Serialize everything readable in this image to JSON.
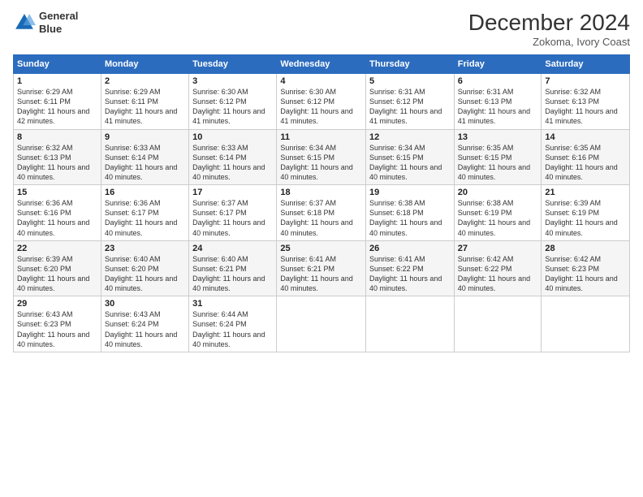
{
  "header": {
    "logo_line1": "General",
    "logo_line2": "Blue",
    "title": "December 2024",
    "location": "Zokoma, Ivory Coast"
  },
  "columns": [
    "Sunday",
    "Monday",
    "Tuesday",
    "Wednesday",
    "Thursday",
    "Friday",
    "Saturday"
  ],
  "weeks": [
    [
      {
        "day": "1",
        "sunrise": "6:29 AM",
        "sunset": "6:11 PM",
        "daylight": "11 hours and 42 minutes."
      },
      {
        "day": "2",
        "sunrise": "6:29 AM",
        "sunset": "6:11 PM",
        "daylight": "11 hours and 41 minutes."
      },
      {
        "day": "3",
        "sunrise": "6:30 AM",
        "sunset": "6:12 PM",
        "daylight": "11 hours and 41 minutes."
      },
      {
        "day": "4",
        "sunrise": "6:30 AM",
        "sunset": "6:12 PM",
        "daylight": "11 hours and 41 minutes."
      },
      {
        "day": "5",
        "sunrise": "6:31 AM",
        "sunset": "6:12 PM",
        "daylight": "11 hours and 41 minutes."
      },
      {
        "day": "6",
        "sunrise": "6:31 AM",
        "sunset": "6:13 PM",
        "daylight": "11 hours and 41 minutes."
      },
      {
        "day": "7",
        "sunrise": "6:32 AM",
        "sunset": "6:13 PM",
        "daylight": "11 hours and 41 minutes."
      }
    ],
    [
      {
        "day": "8",
        "sunrise": "6:32 AM",
        "sunset": "6:13 PM",
        "daylight": "11 hours and 40 minutes."
      },
      {
        "day": "9",
        "sunrise": "6:33 AM",
        "sunset": "6:14 PM",
        "daylight": "11 hours and 40 minutes."
      },
      {
        "day": "10",
        "sunrise": "6:33 AM",
        "sunset": "6:14 PM",
        "daylight": "11 hours and 40 minutes."
      },
      {
        "day": "11",
        "sunrise": "6:34 AM",
        "sunset": "6:15 PM",
        "daylight": "11 hours and 40 minutes."
      },
      {
        "day": "12",
        "sunrise": "6:34 AM",
        "sunset": "6:15 PM",
        "daylight": "11 hours and 40 minutes."
      },
      {
        "day": "13",
        "sunrise": "6:35 AM",
        "sunset": "6:15 PM",
        "daylight": "11 hours and 40 minutes."
      },
      {
        "day": "14",
        "sunrise": "6:35 AM",
        "sunset": "6:16 PM",
        "daylight": "11 hours and 40 minutes."
      }
    ],
    [
      {
        "day": "15",
        "sunrise": "6:36 AM",
        "sunset": "6:16 PM",
        "daylight": "11 hours and 40 minutes."
      },
      {
        "day": "16",
        "sunrise": "6:36 AM",
        "sunset": "6:17 PM",
        "daylight": "11 hours and 40 minutes."
      },
      {
        "day": "17",
        "sunrise": "6:37 AM",
        "sunset": "6:17 PM",
        "daylight": "11 hours and 40 minutes."
      },
      {
        "day": "18",
        "sunrise": "6:37 AM",
        "sunset": "6:18 PM",
        "daylight": "11 hours and 40 minutes."
      },
      {
        "day": "19",
        "sunrise": "6:38 AM",
        "sunset": "6:18 PM",
        "daylight": "11 hours and 40 minutes."
      },
      {
        "day": "20",
        "sunrise": "6:38 AM",
        "sunset": "6:19 PM",
        "daylight": "11 hours and 40 minutes."
      },
      {
        "day": "21",
        "sunrise": "6:39 AM",
        "sunset": "6:19 PM",
        "daylight": "11 hours and 40 minutes."
      }
    ],
    [
      {
        "day": "22",
        "sunrise": "6:39 AM",
        "sunset": "6:20 PM",
        "daylight": "11 hours and 40 minutes."
      },
      {
        "day": "23",
        "sunrise": "6:40 AM",
        "sunset": "6:20 PM",
        "daylight": "11 hours and 40 minutes."
      },
      {
        "day": "24",
        "sunrise": "6:40 AM",
        "sunset": "6:21 PM",
        "daylight": "11 hours and 40 minutes."
      },
      {
        "day": "25",
        "sunrise": "6:41 AM",
        "sunset": "6:21 PM",
        "daylight": "11 hours and 40 minutes."
      },
      {
        "day": "26",
        "sunrise": "6:41 AM",
        "sunset": "6:22 PM",
        "daylight": "11 hours and 40 minutes."
      },
      {
        "day": "27",
        "sunrise": "6:42 AM",
        "sunset": "6:22 PM",
        "daylight": "11 hours and 40 minutes."
      },
      {
        "day": "28",
        "sunrise": "6:42 AM",
        "sunset": "6:23 PM",
        "daylight": "11 hours and 40 minutes."
      }
    ],
    [
      {
        "day": "29",
        "sunrise": "6:43 AM",
        "sunset": "6:23 PM",
        "daylight": "11 hours and 40 minutes."
      },
      {
        "day": "30",
        "sunrise": "6:43 AM",
        "sunset": "6:24 PM",
        "daylight": "11 hours and 40 minutes."
      },
      {
        "day": "31",
        "sunrise": "6:44 AM",
        "sunset": "6:24 PM",
        "daylight": "11 hours and 40 minutes."
      },
      null,
      null,
      null,
      null
    ]
  ]
}
